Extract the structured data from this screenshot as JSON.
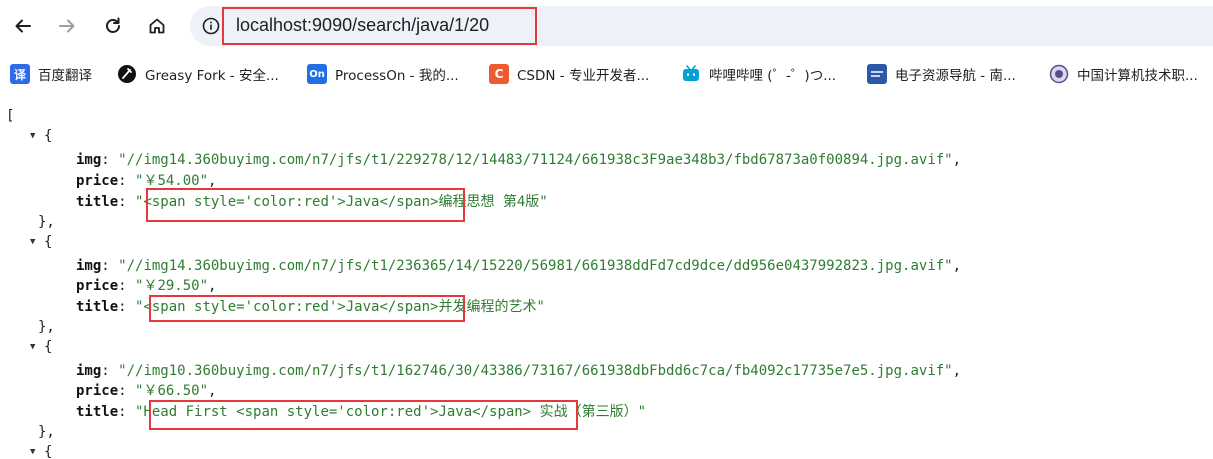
{
  "browser": {
    "url": "localhost:9090/search/java/1/20"
  },
  "bookmarks": [
    {
      "label": "百度翻译",
      "icon": "baidu-translate-icon",
      "glyph": "译",
      "color": "#2e6be6"
    },
    {
      "label": "Greasy Fork - 安全...",
      "icon": "greasy-fork-icon",
      "glyph": "",
      "color": "#111111"
    },
    {
      "label": "ProcessOn - 我的...",
      "icon": "processon-icon",
      "glyph": "On",
      "color": "#1f6fe5"
    },
    {
      "label": "CSDN - 专业开发者...",
      "icon": "csdn-icon",
      "glyph": "C",
      "color": "#f05a30"
    },
    {
      "label": "哔哩哔哩 (゜-゜)つ...",
      "icon": "bilibili-icon",
      "glyph": "",
      "color": "#00a1d6"
    },
    {
      "label": "电子资源导航 - 南...",
      "icon": "e-resource-icon",
      "glyph": "",
      "color": "#2b58a8"
    },
    {
      "label": "中国计算机技术职...",
      "icon": "ccf-icon",
      "glyph": "",
      "color": "#5a4b8f"
    }
  ],
  "json_view": {
    "open_bracket": "[",
    "open_brace": "{",
    "close_brace": "},",
    "keys": {
      "img": "img",
      "price": "price",
      "title": "title"
    },
    "items": [
      {
        "img": "\"//img14.360buyimg.com/n7/jfs/t1/229278/12/14483/71124/661938c3F9ae348b3/fbd67873a0f00894.jpg.avif\"",
        "price": "\"￥54.00\"",
        "title": "\"<span style='color:red'>Java</span>编程思想 第4版\""
      },
      {
        "img": "\"//img14.360buyimg.com/n7/jfs/t1/236365/14/15220/56981/661938ddFd7cd9dce/dd956e0437992823.jpg.avif\"",
        "price": "\"￥29.50\"",
        "title": "\"<span style='color:red'>Java</span>并发编程的艺术\""
      },
      {
        "img": "\"//img10.360buyimg.com/n7/jfs/t1/162746/30/43386/73167/661938dbFbdd6c7ca/fb4092c17735e7e5.jpg.avif\"",
        "price": "\"￥66.50\"",
        "title": "\"Head First <span style='color:red'>Java</span> 实战（第三版）\""
      }
    ]
  }
}
